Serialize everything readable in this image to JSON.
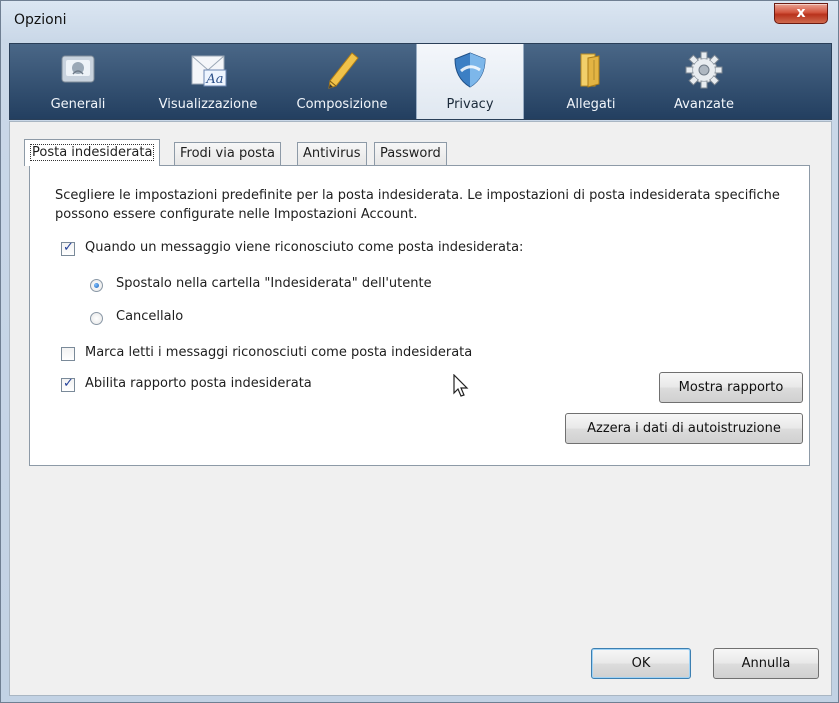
{
  "window": {
    "title": "Opzioni",
    "close_label": "x"
  },
  "toolbar": {
    "items": [
      {
        "label": "Generali",
        "icon": "general-settings-icon"
      },
      {
        "label": "Visualizzazione",
        "icon": "display-icon"
      },
      {
        "label": "Composizione",
        "icon": "pencil-icon"
      },
      {
        "label": "Privacy",
        "icon": "shield-icon"
      },
      {
        "label": "Allegati",
        "icon": "attachment-folder-icon"
      },
      {
        "label": "Avanzate",
        "icon": "gear-icon"
      }
    ],
    "active": "Privacy",
    "display_icon_text": "Aa"
  },
  "tabs": [
    "Posta indesiderata",
    "Frodi via posta",
    "Antivirus",
    "Password"
  ],
  "active_tab": "Posta indesiderata",
  "panel": {
    "description": "Scegliere le impostazioni predefinite per la posta indesiderata. Le impostazioni di posta indesiderata specifiche possono essere configurate nelle Impostazioni Account.",
    "when_junk_label": "Quando un messaggio viene riconosciuto come posta indesiderata:",
    "when_junk_checked": true,
    "move_label": "Spostalo nella cartella \"Indesiderata\" dell'utente",
    "move_selected": true,
    "delete_label": "Cancellalo",
    "delete_selected": false,
    "mark_read_label": "Marca letti i messaggi riconosciuti come posta indesiderata",
    "mark_read_checked": false,
    "enable_log_label": "Abilita rapporto posta indesiderata",
    "enable_log_checked": true,
    "show_log_button": "Mostra rapporto",
    "reset_training_button": "Azzera i dati di autoistruzione"
  },
  "footer": {
    "ok_label": "OK",
    "cancel_label": "Annulla"
  },
  "colors": {
    "toolbar_top": "#4a6787",
    "toolbar_bottom": "#233f60",
    "close_red": "#c8412a"
  }
}
